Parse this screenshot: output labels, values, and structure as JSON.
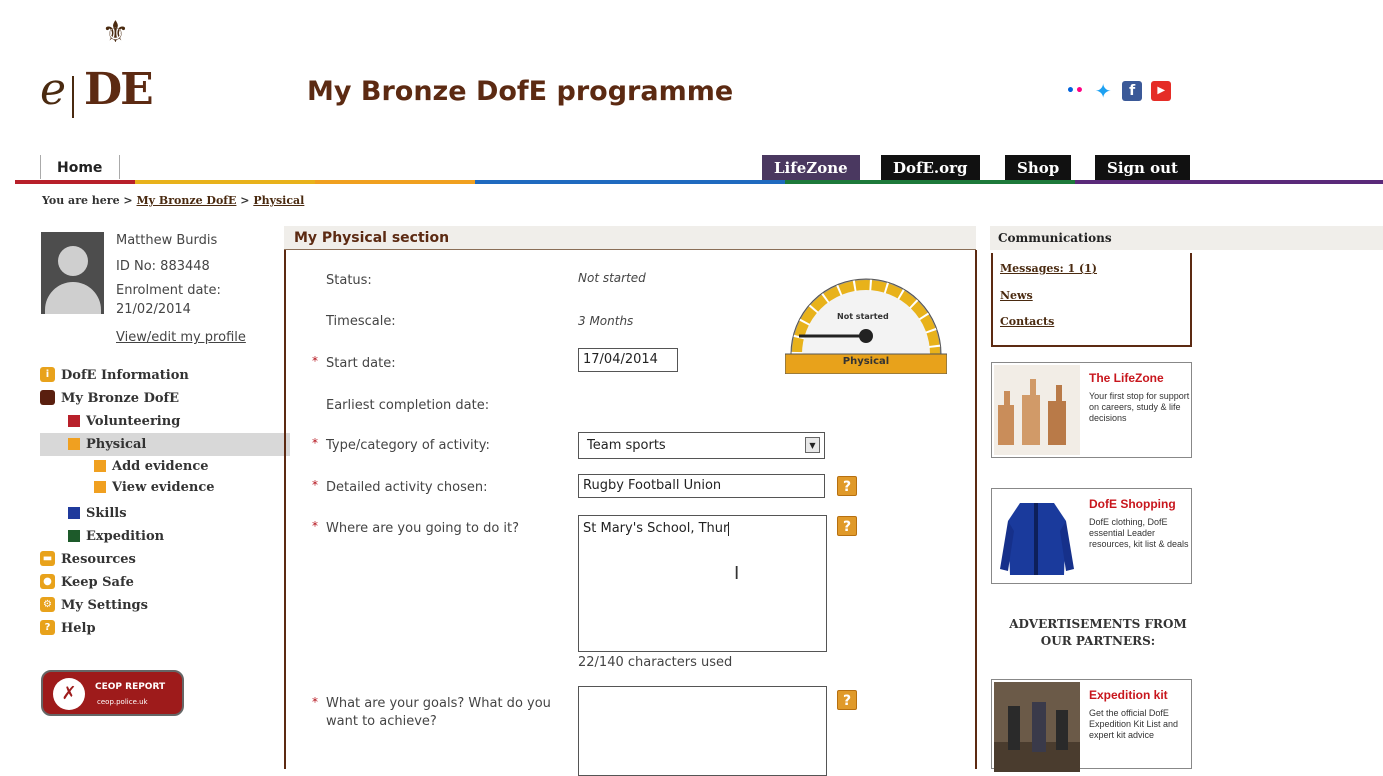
{
  "header": {
    "logo_text_e": "e",
    "logo_text_de": "DE",
    "page_title": "My Bronze DofE programme",
    "social_icons": [
      "flickr-icon",
      "twitter-icon",
      "facebook-icon",
      "youtube-icon"
    ]
  },
  "nav": {
    "home": "Home",
    "lifezone": "LifeZone",
    "dofe_org": "DofE.org",
    "shop": "Shop",
    "sign_out": "Sign out"
  },
  "breadcrumb": {
    "prefix": "You are here >",
    "crumb1": "My Bronze DofE",
    "sep": ">",
    "crumb2": "Physical"
  },
  "profile": {
    "name": "Matthew Burdis",
    "id": "ID No: 883448",
    "enrol_label": "Enrolment date:",
    "enrol_date": "21/02/2014",
    "edit_link": "View/edit my profile"
  },
  "sidebar": {
    "items": [
      {
        "label": "DofE Information",
        "icon": "info-icon",
        "color": "#e8a21b"
      },
      {
        "label": "My Bronze DofE",
        "icon": "square-icon",
        "color": "#5a1f0f"
      },
      {
        "label": "Volunteering",
        "icon": "square-icon",
        "color": "#b8202a"
      },
      {
        "label": "Physical",
        "icon": "square-icon",
        "color": "#f0a020"
      },
      {
        "label": "Add evidence",
        "icon": "square-icon",
        "color": "#f0a020"
      },
      {
        "label": "View evidence",
        "icon": "square-icon",
        "color": "#f0a020"
      },
      {
        "label": "Skills",
        "icon": "square-icon",
        "color": "#1f3a9c"
      },
      {
        "label": "Expedition",
        "icon": "square-icon",
        "color": "#1d5a2a"
      },
      {
        "label": "Resources",
        "icon": "folder-icon",
        "color": "#e8a21b"
      },
      {
        "label": "Keep Safe",
        "icon": "shield-icon",
        "color": "#e8a21b"
      },
      {
        "label": "My Settings",
        "icon": "gear-icon",
        "color": "#e8a21b"
      },
      {
        "label": "Help",
        "icon": "help-icon",
        "color": "#e8a21b"
      }
    ],
    "ceop_title": "CEOP REPORT",
    "ceop_sub": "ceop.police.uk"
  },
  "main": {
    "title": "My Physical section",
    "status_label": "Status:",
    "status_value": "Not started",
    "timescale_label": "Timescale:",
    "timescale_value": "3 Months",
    "start_label": "Start date:",
    "start_value": "17/04/2014",
    "earliest_label": "Earliest completion date:",
    "type_label": "Type/category of activity:",
    "type_value": "Team sports",
    "detail_label": "Detailed activity chosen:",
    "detail_value": "Rugby Football Union",
    "where_label": "Where are you going to do it?",
    "where_value": "St Mary's School, Thur",
    "where_counter": "22/140 characters used",
    "goals_label": "What are your goals? What do you want to achieve?",
    "required_mark": "*",
    "help_glyph": "?",
    "gauge_text": "Not started",
    "gauge_label": "Physical",
    "gauge_level": 0
  },
  "right": {
    "comm_title": "Communications",
    "messages": "Messages: 1 (1)",
    "news": "News",
    "contacts": "Contacts",
    "promos": [
      {
        "title": "The LifeZone",
        "desc": "Your first stop for support on careers, study & life decisions"
      },
      {
        "title": "DofE Shopping",
        "desc": "DofE clothing, DofE essential Leader resources, kit list & deals"
      },
      {
        "title": "Expedition kit",
        "desc": "Get the official DofE Expedition Kit List and expert kit advice"
      }
    ],
    "ads_title": "ADVERTISEMENTS FROM OUR PARTNERS:"
  },
  "colors": {
    "brand_brown": "#5c2a12",
    "required_red": "#b5121b",
    "help_orange": "#e09a2a",
    "nav_black": "#111111",
    "lifezone_tab": "#4a3860"
  }
}
